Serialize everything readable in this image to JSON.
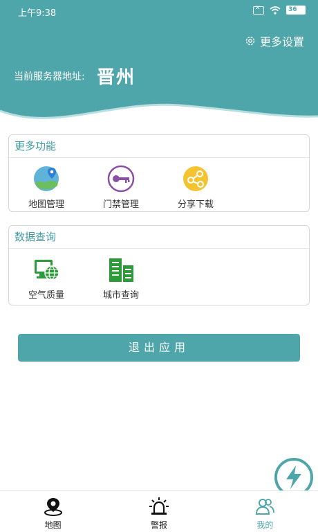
{
  "status_bar": {
    "time": "上午9:38",
    "battery": "36"
  },
  "header": {
    "settings_label": "更多设置",
    "server_label": "当前服务器地址:",
    "server_value": "晋州"
  },
  "more_functions": {
    "title": "更多功能",
    "items": [
      {
        "label": "地图管理",
        "icon": "map-icon"
      },
      {
        "label": "门禁管理",
        "icon": "key-icon"
      },
      {
        "label": "分享下载",
        "icon": "share-icon"
      }
    ]
  },
  "data_query": {
    "title": "数据查询",
    "items": [
      {
        "label": "空气质量",
        "icon": "monitor-globe-icon"
      },
      {
        "label": "城市查询",
        "icon": "buildings-icon"
      }
    ]
  },
  "exit_button": "退出应用",
  "bottom_nav": [
    {
      "label": "地图",
      "icon": "location-icon"
    },
    {
      "label": "警报",
      "icon": "alarm-icon"
    },
    {
      "label": "我的",
      "icon": "users-icon"
    }
  ],
  "colors": {
    "accent": "#4fa6aa"
  }
}
